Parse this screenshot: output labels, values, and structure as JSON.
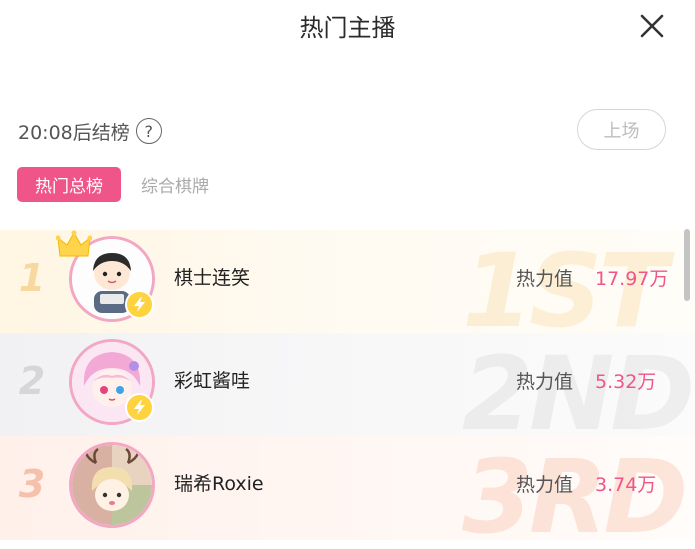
{
  "header": {
    "title": "热门主播",
    "close_icon": "close-icon"
  },
  "countdown": {
    "text": "20:08后结榜",
    "help_symbol": "?"
  },
  "join_button": {
    "label": "上场"
  },
  "tabs": [
    {
      "label": "热门总榜",
      "active": true
    },
    {
      "label": "综合棋牌",
      "active": false
    }
  ],
  "ranking": [
    {
      "rank": "1",
      "name": "棋士连笑",
      "heat_label": "热力值",
      "heat_value": "17.97万",
      "watermark": "1ST",
      "icons": [
        "crown-icon",
        "lightning-badge-icon"
      ]
    },
    {
      "rank": "2",
      "name": "彩虹酱哇",
      "heat_label": "热力值",
      "heat_value": "5.32万",
      "watermark": "2ND",
      "icons": [
        "lightning-badge-icon"
      ]
    },
    {
      "rank": "3",
      "name": "瑞希Roxie",
      "heat_label": "热力值",
      "heat_value": "3.74万",
      "watermark": "3RD",
      "icons": []
    }
  ],
  "colors": {
    "accent": "#f0558a",
    "gold": "#f7d9a0",
    "silver": "#d6d6d6",
    "bronze": "#f6c1aa"
  }
}
